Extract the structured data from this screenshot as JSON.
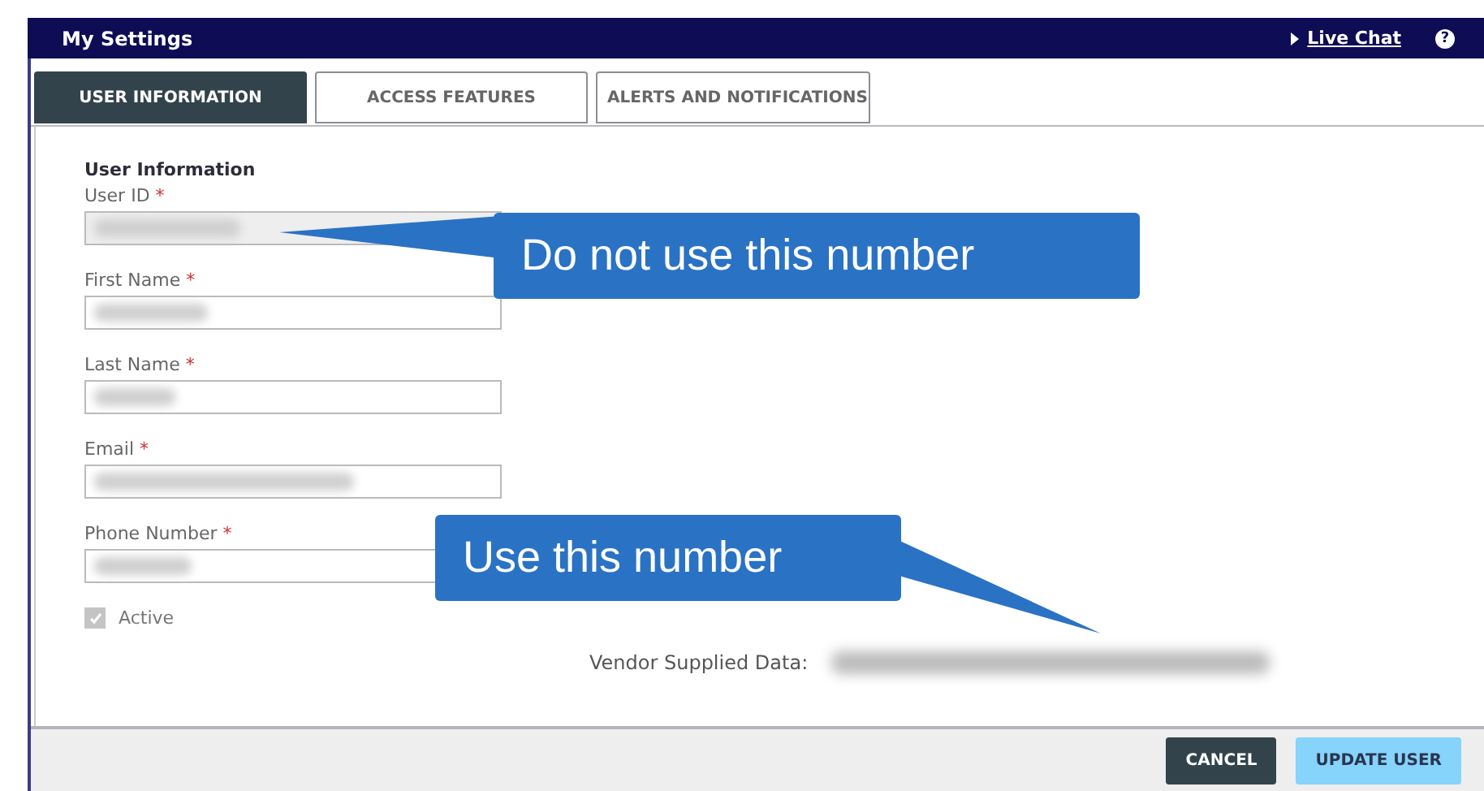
{
  "header": {
    "title": "My Settings",
    "link": "Live Chat",
    "help": "?"
  },
  "tabs": [
    {
      "label": "USER INFORMATION",
      "selected": true
    },
    {
      "label": "ACCESS FEATURES",
      "selected": false
    },
    {
      "label": "ALERTS AND NOTIFICATIONS",
      "selected": false
    }
  ],
  "section_title": "User Information",
  "fields": [
    {
      "label": "User ID",
      "required": true,
      "disabled": true
    },
    {
      "label": "First Name",
      "required": true,
      "disabled": false
    },
    {
      "label": "Last Name",
      "required": true,
      "disabled": false
    },
    {
      "label": "Email",
      "required": true,
      "disabled": false
    },
    {
      "label": "Phone Number",
      "required": true,
      "disabled": false
    }
  ],
  "required_mark": "*",
  "active": {
    "label": "Active",
    "checked": true,
    "disabled": true
  },
  "vendor": {
    "label": "Vendor Supplied Data:"
  },
  "callouts": [
    "Do not use this number",
    "Use this number"
  ],
  "buttons": [
    {
      "label": "CANCEL",
      "kind": "secondary"
    },
    {
      "label": "UPDATE USER",
      "kind": "primary"
    }
  ]
}
